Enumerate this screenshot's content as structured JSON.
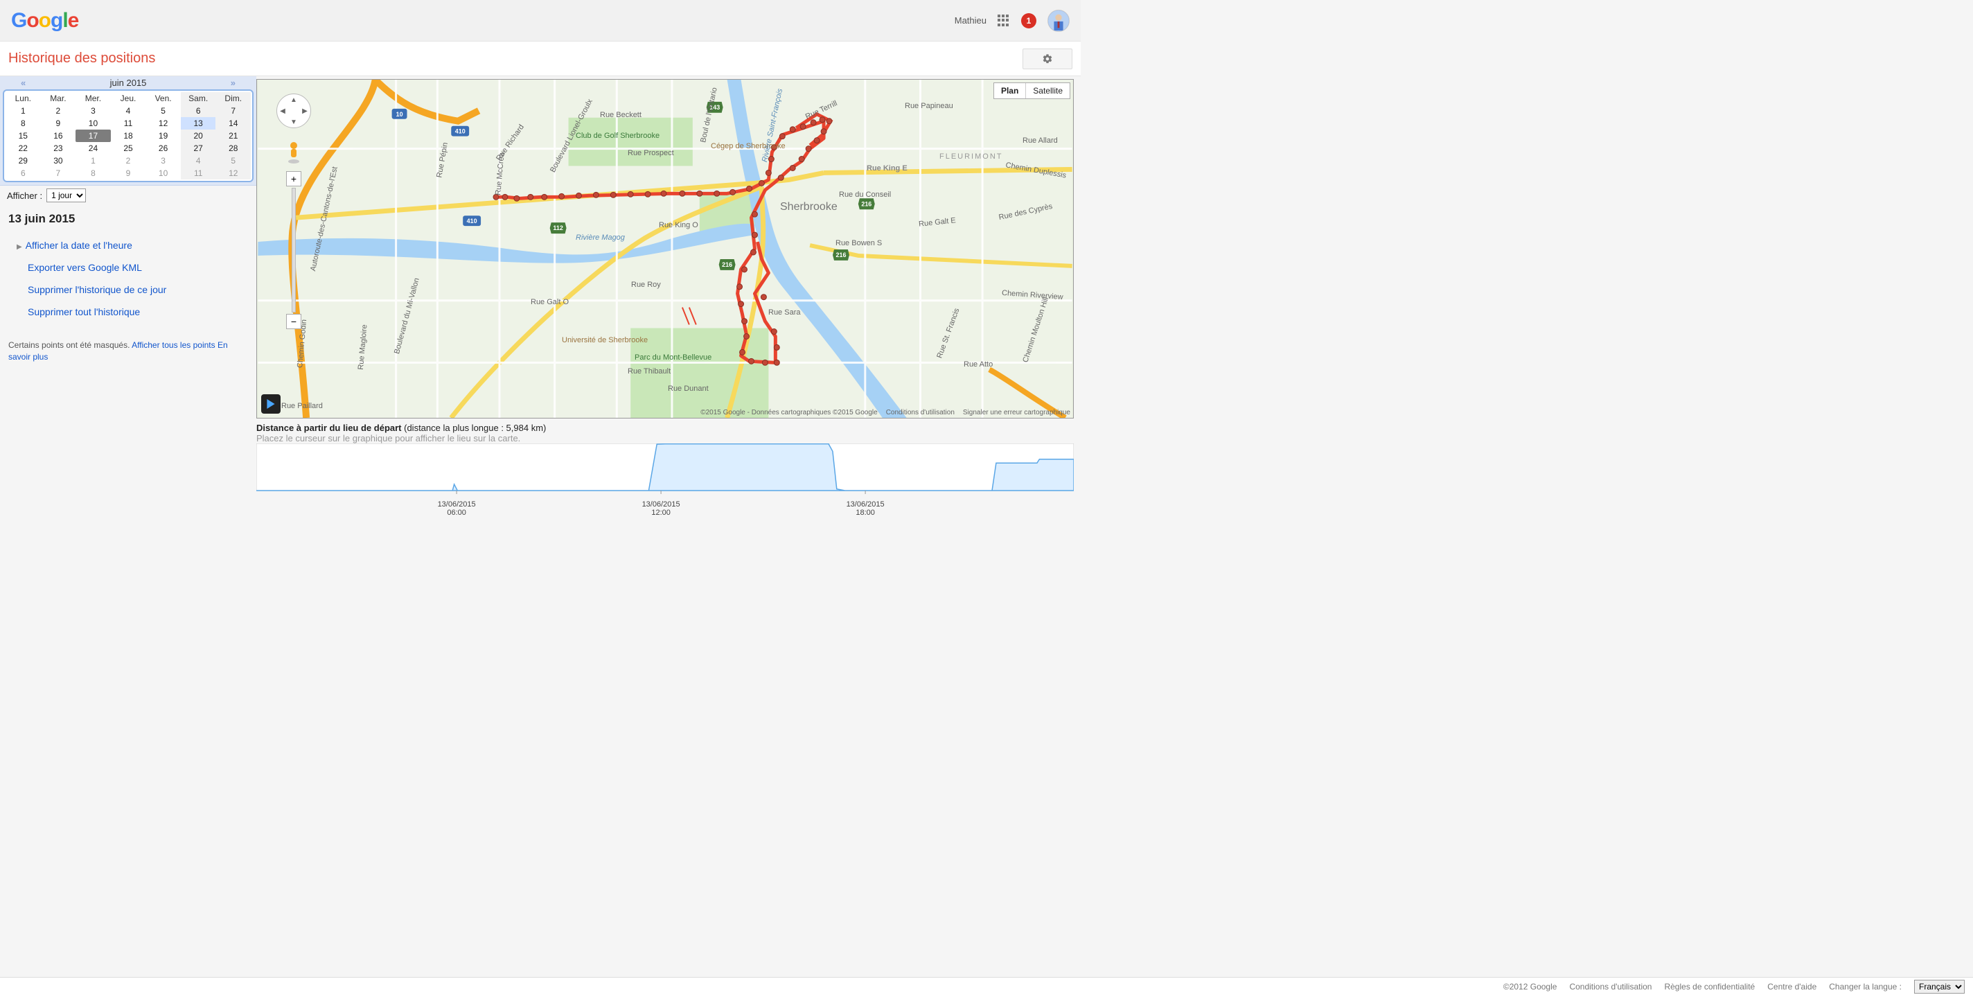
{
  "header": {
    "logo": {
      "g1": "G",
      "o1": "o",
      "o2": "o",
      "g2": "g",
      "l": "l",
      "e": "e"
    },
    "user_name": "Mathieu",
    "notification_count": "1"
  },
  "page": {
    "title": "Historique des positions"
  },
  "calendar": {
    "nav_prev": "«",
    "month_label": "juin 2015",
    "nav_next": "»",
    "weekdays": [
      "Lun.",
      "Mar.",
      "Mer.",
      "Jeu.",
      "Ven.",
      "Sam.",
      "Dim."
    ],
    "weeks": [
      [
        {
          "n": "1"
        },
        {
          "n": "2"
        },
        {
          "n": "3"
        },
        {
          "n": "4"
        },
        {
          "n": "5"
        },
        {
          "n": "6",
          "we": true
        },
        {
          "n": "7",
          "we": true
        }
      ],
      [
        {
          "n": "8"
        },
        {
          "n": "9"
        },
        {
          "n": "10"
        },
        {
          "n": "11"
        },
        {
          "n": "12"
        },
        {
          "n": "13",
          "we": true,
          "sel": true
        },
        {
          "n": "14",
          "we": true
        }
      ],
      [
        {
          "n": "15"
        },
        {
          "n": "16"
        },
        {
          "n": "17",
          "today": true
        },
        {
          "n": "18"
        },
        {
          "n": "19"
        },
        {
          "n": "20",
          "we": true
        },
        {
          "n": "21",
          "we": true
        }
      ],
      [
        {
          "n": "22"
        },
        {
          "n": "23"
        },
        {
          "n": "24"
        },
        {
          "n": "25"
        },
        {
          "n": "26"
        },
        {
          "n": "27",
          "we": true
        },
        {
          "n": "28",
          "we": true
        }
      ],
      [
        {
          "n": "29"
        },
        {
          "n": "30"
        },
        {
          "n": "1",
          "off": true
        },
        {
          "n": "2",
          "off": true
        },
        {
          "n": "3",
          "off": true
        },
        {
          "n": "4",
          "off": true,
          "we": true
        },
        {
          "n": "5",
          "off": true,
          "we": true
        }
      ],
      [
        {
          "n": "6",
          "off": true
        },
        {
          "n": "7",
          "off": true
        },
        {
          "n": "8",
          "off": true
        },
        {
          "n": "9",
          "off": true
        },
        {
          "n": "10",
          "off": true
        },
        {
          "n": "11",
          "off": true,
          "we": true
        },
        {
          "n": "12",
          "off": true,
          "we": true
        }
      ]
    ],
    "display_label": "Afficher :",
    "display_value": "1 jour"
  },
  "selected_date": "13 juin 2015",
  "links": {
    "show_time": "Afficher la date et l'heure",
    "export_kml": "Exporter vers Google KML",
    "delete_day": "Supprimer l'historique de ce jour",
    "delete_all": "Supprimer tout l'historique"
  },
  "masked": {
    "text": "Certains points ont été masqués. ",
    "show_all": "Afficher tous les points",
    "learn_more": "En savoir plus"
  },
  "map": {
    "type_plan": "Plan",
    "type_sat": "Satellite",
    "city_label": "Sherbrooke",
    "hwy_10": "10",
    "hwy_410a": "410",
    "hwy_410b": "410",
    "hwy_112": "112",
    "hwy_143": "143",
    "hwy_216a": "216",
    "hwy_216b": "216",
    "hwy_216c": "216",
    "labels": {
      "rue_beckett": "Rue Beckett",
      "rue_pepin": "Rue Pépin",
      "rue_richard": "Rue Richard",
      "golf": "Club de Golf Sherbrooke",
      "cegep": "Cégep de Sherbrooke",
      "rue_papineau": "Rue Papineau",
      "fleurimont": "FLEURIMONT",
      "rue_allard": "Rue Allard",
      "chemin_duplessis": "Chemin Duplessis",
      "rue_prospect": "Rue Prospect",
      "rue_king_e": "Rue King E",
      "rue_conseil": "Rue du Conseil",
      "rue_king_o": "Rue King O",
      "riviere_magog": "Rivière Magog",
      "rue_bowen": "Rue Bowen S",
      "rue_galt_e": "Rue Galt E",
      "rue_cypres": "Rue des Cyprès",
      "rue_roy": "Rue Roy",
      "rue_galt_o": "Rue Galt O",
      "chemin_riverview": "Chemin Riverview",
      "bd_mivallon": "Boulevard du Mi-Vallon",
      "rue_magloire": "Rue Magloire",
      "udes": "Université de Sherbrooke",
      "parc": "Parc du Mont-Bellevue",
      "rue_sara": "Rue Sara",
      "rue_st_francis": "Rue St. Francis",
      "chemin_moulton": "Chemin Moulton Hill",
      "rue_atto": "Rue Atto",
      "rue_thibault": "Rue Thibault",
      "rue_dunant": "Rue Dunant",
      "rue_paillard": "Rue Paillard",
      "autoroute": "Autoroute-des-Cantons-de-l'Est",
      "chemin_godin": "Chemin Godin",
      "rue_mccrea": "Rue McCrea",
      "bd_lionel": "Boulevard Lionel-Groulx",
      "bd_ontario": "Boul de l'Ontario",
      "rue_terrill": "Rue Terrill",
      "riviere_st_francois": "Rivière Saint-François"
    },
    "attrib_text": "©2015 Google - Données cartographiques ©2015 Google",
    "attrib_terms": "Conditions d'utilisation",
    "attrib_report": "Signaler une erreur cartographique"
  },
  "chart_data": {
    "type": "area",
    "title_prefix": "Distance à partir du lieu de départ ",
    "title_paren": "(distance la plus longue : 5,984 km)",
    "subtitle": "Placez le curseur sur le graphique pour afficher le lieu sur la carte.",
    "xlabel": "",
    "ylabel": "",
    "ylim": [
      0,
      6.0
    ],
    "series": [
      {
        "name": "distance_km",
        "points": [
          [
            0.0,
            0.0
          ],
          [
            0.24,
            0.0
          ],
          [
            0.242,
            0.8
          ],
          [
            0.246,
            0.0
          ],
          [
            0.48,
            0.0
          ],
          [
            0.49,
            5.9
          ],
          [
            0.5,
            5.95
          ],
          [
            0.7,
            5.95
          ],
          [
            0.705,
            5.0
          ],
          [
            0.71,
            0.2
          ],
          [
            0.72,
            0.0
          ],
          [
            0.9,
            0.0
          ],
          [
            0.905,
            3.5
          ],
          [
            0.91,
            3.5
          ],
          [
            0.955,
            3.5
          ],
          [
            0.958,
            4.0
          ],
          [
            1.0,
            4.0
          ]
        ]
      }
    ],
    "x_ticks": [
      {
        "pos": 0.245,
        "label_top": "13/06/2015",
        "label_bot": "06:00"
      },
      {
        "pos": 0.495,
        "label_top": "13/06/2015",
        "label_bot": "12:00"
      },
      {
        "pos": 0.745,
        "label_top": "13/06/2015",
        "label_bot": "18:00"
      }
    ]
  },
  "footer": {
    "copyright": "©2012 Google",
    "terms": "Conditions d'utilisation",
    "privacy": "Règles de confidentialité",
    "help": "Centre d'aide",
    "lang_label": "Changer la langue :",
    "lang_value": "Français"
  }
}
